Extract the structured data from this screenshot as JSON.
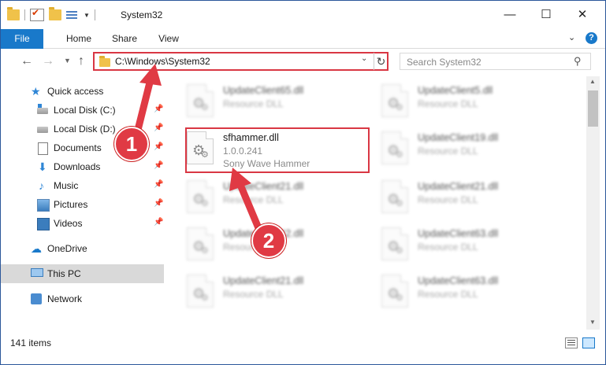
{
  "window": {
    "title": "System32",
    "controls": {
      "minimize": "—",
      "maximize": "☐",
      "close": "✕"
    }
  },
  "ribbon": {
    "tabs": [
      "File",
      "Home",
      "Share",
      "View"
    ],
    "help_icon": "?"
  },
  "address_bar": {
    "path": "C:\\Windows\\System32"
  },
  "search": {
    "placeholder": "Search System32"
  },
  "sidebar": {
    "items": [
      {
        "label": "Quick access",
        "icon": "star-icon"
      },
      {
        "label": "Local Disk (C:)",
        "icon": "disk-icon",
        "pinned": true
      },
      {
        "label": "Local Disk (D:)",
        "icon": "disk-icon",
        "pinned": true
      },
      {
        "label": "Documents",
        "icon": "documents-icon",
        "pinned": true
      },
      {
        "label": "Downloads",
        "icon": "download-icon",
        "pinned": true
      },
      {
        "label": "Music",
        "icon": "music-icon",
        "pinned": true
      },
      {
        "label": "Pictures",
        "icon": "pictures-icon",
        "pinned": true
      },
      {
        "label": "Videos",
        "icon": "videos-icon",
        "pinned": true
      },
      {
        "label": "OneDrive",
        "icon": "cloud-icon"
      },
      {
        "label": "This PC",
        "icon": "computer-icon",
        "selected": true
      },
      {
        "label": "Network",
        "icon": "network-icon"
      }
    ]
  },
  "files": [
    {
      "name": "UpdateClient65.dll",
      "desc": "Resource DLL",
      "blurred": true
    },
    {
      "name": "UpdateClient5.dll",
      "desc": "Resource DLL",
      "blurred": true
    },
    {
      "name": "sfhammer.dll",
      "version": "1.0.0.241",
      "desc": "Sony Wave Hammer",
      "blurred": false,
      "highlighted": true
    },
    {
      "name": "UpdateClient19.dll",
      "desc": "Resource DLL",
      "blurred": true
    },
    {
      "name": "UpdateClient21.dll",
      "desc": "Resource DLL",
      "blurred": true
    },
    {
      "name": "UpdateClient21.dll",
      "desc": "Resource DLL",
      "blurred": true
    },
    {
      "name": "UpdateClient42.dll",
      "desc": "Resource DLL",
      "blurred": true
    },
    {
      "name": "UpdateClient63.dll",
      "desc": "Resource DLL",
      "blurred": true
    },
    {
      "name": "UpdateClient21.dll",
      "desc": "Resource DLL",
      "blurred": true
    },
    {
      "name": "UpdateClient63.dll",
      "desc": "Resource DLL",
      "blurred": true
    }
  ],
  "status": {
    "item_count": "141 items"
  },
  "annotations": {
    "step1": "1",
    "step2": "2",
    "color": "#e03a44"
  }
}
